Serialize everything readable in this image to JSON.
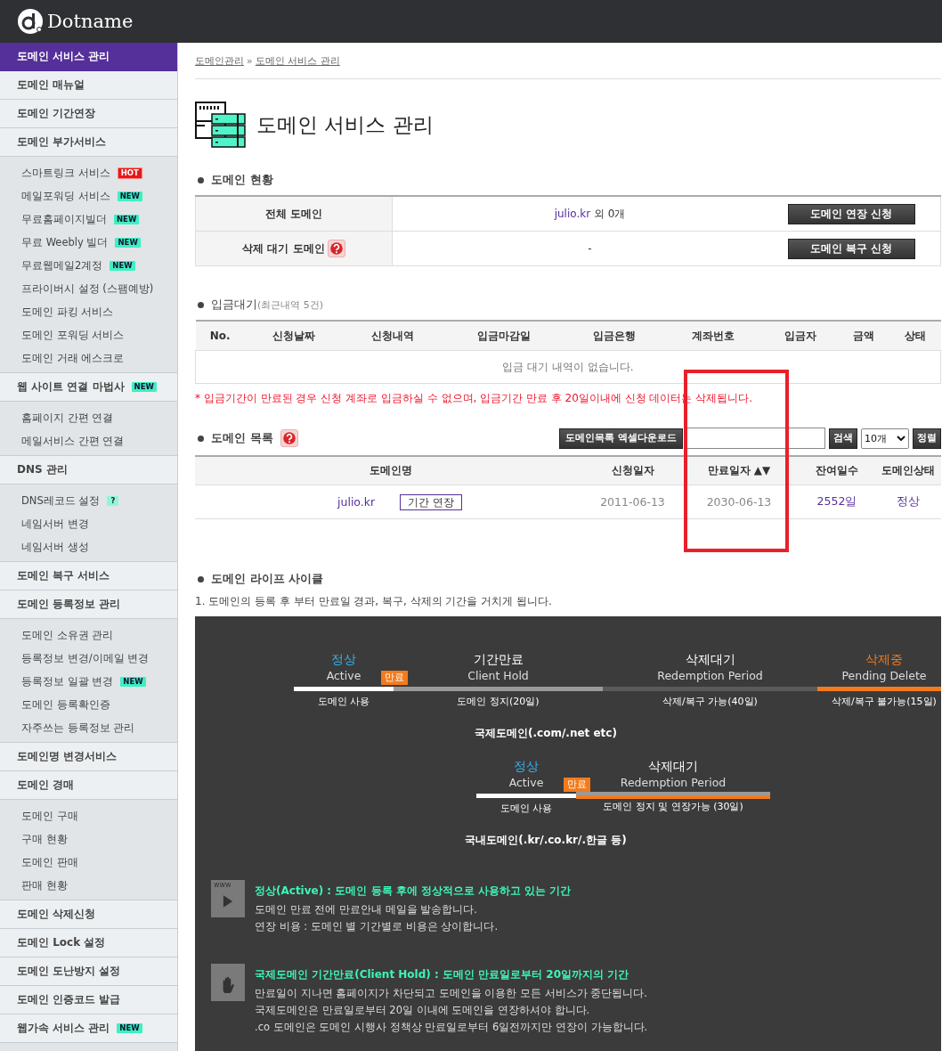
{
  "header": {
    "brand": "Dotname"
  },
  "sidebar": {
    "items": [
      {
        "label": "도메인 서비스 관리",
        "selected": true
      },
      {
        "label": "도메인 매뉴얼",
        "selected": false
      },
      {
        "label": "도메인 기간연장",
        "selected": false
      },
      {
        "label": "도메인 부가서비스",
        "selected": false,
        "children": [
          {
            "label": "스마트링크 서비스",
            "selected": false,
            "badge": {
              "kind": "hot",
              "text": "HOT"
            }
          },
          {
            "label": "메일포워딩 서비스",
            "selected": false,
            "badge": {
              "kind": "new",
              "text": "NEW"
            }
          },
          {
            "label": "무료홈페이지빌더",
            "selected": false,
            "badge": {
              "kind": "new",
              "text": "NEW"
            }
          },
          {
            "label": "무료 Weebly 빌더",
            "selected": false,
            "badge": {
              "kind": "new",
              "text": "NEW"
            }
          },
          {
            "label": "무료웹메일2계정",
            "selected": false,
            "badge": {
              "kind": "new",
              "text": "NEW"
            }
          },
          {
            "label": "프라이버시 설정 (스팸예방)",
            "selected": false
          },
          {
            "label": "도메인 파킹 서비스",
            "selected": false
          },
          {
            "label": "도메인 포워딩 서비스",
            "selected": false
          },
          {
            "label": "도메인 거래 에스크로",
            "selected": false
          }
        ]
      },
      {
        "label": "웹 사이트 연결 마법사",
        "selected": false,
        "badge": {
          "kind": "new",
          "text": "NEW"
        },
        "children": [
          {
            "label": "홈페이지 간편 연결",
            "selected": false
          },
          {
            "label": "메일서비스 간편 연결",
            "selected": false
          }
        ]
      },
      {
        "label": "DNS 관리",
        "selected": false,
        "children": [
          {
            "label": "DNS레코드 설정",
            "selected": false,
            "badge": {
              "kind": "help",
              "text": "?"
            }
          },
          {
            "label": "네임서버 변경",
            "selected": false
          },
          {
            "label": "네임서버 생성",
            "selected": false
          }
        ]
      },
      {
        "label": "도메인 복구 서비스",
        "selected": false
      },
      {
        "label": "도메인 등록정보 관리",
        "selected": false,
        "children": [
          {
            "label": "도메인 소유권 관리",
            "selected": false
          },
          {
            "label": "등록정보 변경/이메일 변경",
            "selected": false
          },
          {
            "label": "등록정보 일괄 변경",
            "selected": false,
            "badge": {
              "kind": "new",
              "text": "NEW"
            }
          },
          {
            "label": "도메인 등록확인증",
            "selected": false
          },
          {
            "label": "자주쓰는 등록정보 관리",
            "selected": false
          }
        ]
      },
      {
        "label": "도메인명 변경서비스",
        "selected": false
      },
      {
        "label": "도메인 경매",
        "selected": false,
        "children": [
          {
            "label": "도메인 구매",
            "selected": false
          },
          {
            "label": "구매 현황",
            "selected": false
          },
          {
            "label": "도메인 판매",
            "selected": false
          },
          {
            "label": "판매 현황",
            "selected": false
          }
        ]
      },
      {
        "label": "도메인 삭제신청",
        "selected": false
      },
      {
        "label": "도메인 Lock 설정",
        "selected": false
      },
      {
        "label": "도메인 도난방지 설정",
        "selected": false
      },
      {
        "label": "도메인 인증코드 발급",
        "selected": false
      },
      {
        "label": "웹가속 서비스 관리",
        "selected": false,
        "badge": {
          "kind": "new",
          "text": "NEW"
        }
      }
    ]
  },
  "breadcrumb": {
    "separator": "»",
    "items": [
      {
        "label": "도메인관리"
      },
      {
        "label": "도메인 서비스 관리"
      }
    ]
  },
  "page_title": "도메인 서비스 관리",
  "status_section": {
    "heading": "도메인 현황",
    "rows": [
      {
        "label": "전체 도메인",
        "help": false,
        "link": "julio.kr",
        "value": " 외 0개",
        "button": "도메인 연장 신청"
      },
      {
        "label": "삭제 대기 도메인",
        "help": true,
        "value": "-",
        "button": "도메인 복구 신청"
      }
    ]
  },
  "payments": {
    "heading": "입금대기",
    "note": "(최근내역 5건)",
    "columns": [
      "No.",
      "신청날짜",
      "신청내역",
      "입금마감일",
      "입금은행",
      "계좌번호",
      "입금자",
      "금액",
      "상태"
    ],
    "empty": "입금 대기 내역이 없습니다.",
    "warning": "* 입금기간이 만료된 경우 신청 계좌로 입금하실 수 없으며, 입금기간 만료 후 20일이내에 신청 데이터는 삭제됩니다."
  },
  "domains": {
    "heading": "도메인 목록",
    "help": true,
    "export_button": "도메인목록 엑셀다운로드",
    "search_button": "검색",
    "page_size": "10개",
    "sort_button": "정렬",
    "columns": [
      "도메인명",
      "신청일자",
      "만료일자 ▲▼",
      "잔여일수",
      "도메인상태"
    ],
    "rows": [
      {
        "domain": "julio.kr",
        "action": "기간 연장",
        "registered": "2011-06-13",
        "expires": "2030-06-13",
        "remaining": "2552일",
        "status": "정상"
      }
    ],
    "highlight": {
      "kind": "box"
    }
  },
  "lifecycle": {
    "heading": "도메인 라이프 사이클",
    "intro": "1. 도메인의 등록 후 부터 만료일 경과, 복구, 삭제의 기간을 거치게 됩니다.",
    "diagrams": [
      {
        "kind": "international",
        "marker": "만료",
        "caption": "국제도메인(.com/.net etc)",
        "phases": [
          {
            "kind": "active",
            "name": "정상",
            "english": "Active",
            "detail": "도메인 사용"
          },
          {
            "kind": "hold",
            "name": "기간만료",
            "english": "Client Hold",
            "detail": "도메인 정지(20일)"
          },
          {
            "kind": "redemption",
            "name": "삭제대기",
            "english": "Redemption Period",
            "detail": "삭제/복구 가능(40일)"
          },
          {
            "kind": "pending",
            "name": "삭제중",
            "english": "Pending Delete",
            "detail": "삭제/복구 불가능(15일)"
          }
        ]
      },
      {
        "kind": "domestic",
        "marker": "만료",
        "caption": "국내도메인(.kr/.co.kr/.한글 등)",
        "phases": [
          {
            "kind": "active",
            "name": "정상",
            "english": "Active",
            "detail": "도메인 사용"
          },
          {
            "kind": "grace",
            "name": "삭제대기",
            "english": "Redemption Period",
            "detail": "도메인 정지 및 연장가능 (30일)"
          }
        ]
      }
    ],
    "info": [
      {
        "kind": "www",
        "icon_label": "www",
        "title": "정상(Active) : 도메인 등록 후에 정상적으로 사용하고 있는 기간",
        "lines": [
          "도메인 만료 전에 만료안내 메일을 발송합니다.",
          "연장 비용 : 도메인 별 기간별로 비용은 상이합니다."
        ]
      },
      {
        "kind": "hand",
        "title": "국제도메인 기간만료(Client Hold) : 도메인 만료일로부터 20일까지의 기간",
        "lines": [
          "만료일이 지나면 홈페이지가 차단되고 도메인을 이용한 모든 서비스가 중단됩니다.",
          "국제도메인은 만료일로부터 20일 이내에 도메인을 연장하셔야 합니다.",
          ".co 도메인은 도메인 시행사 정책상 만료일로부터 6일전까지만 연장이 가능합니다."
        ]
      }
    ]
  }
}
